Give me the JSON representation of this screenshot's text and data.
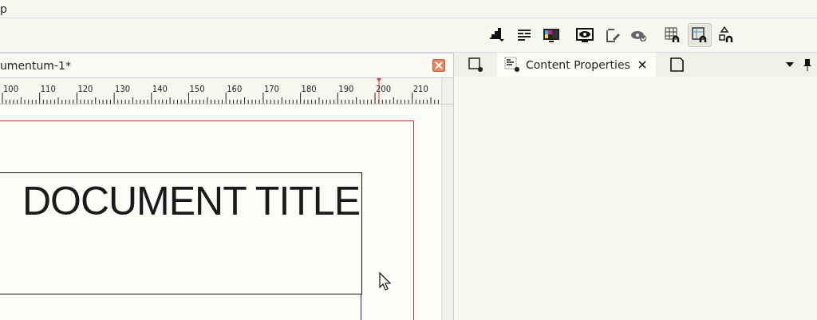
{
  "menu_bar": {
    "items": [
      "p"
    ]
  },
  "toolbar": {
    "tools": [
      {
        "kind": "preview-page",
        "selected": false
      },
      {
        "kind": "text-lines",
        "selected": false
      },
      {
        "kind": "color-monitor",
        "selected": false
      },
      {
        "kind": "eye-monitor",
        "selected": false
      },
      {
        "kind": "page-edit",
        "selected": false
      },
      {
        "kind": "eye-check",
        "selected": false
      },
      {
        "kind": "grid-magnet",
        "selected": false
      },
      {
        "kind": "guide-magnet",
        "selected": true
      },
      {
        "kind": "shape-magnet",
        "selected": false
      }
    ]
  },
  "document_tab": {
    "title": "umentum-1*"
  },
  "ruler": {
    "labels": [
      "100",
      "110",
      "120",
      "130",
      "140",
      "150",
      "160",
      "170",
      "180",
      "190",
      "200",
      "210"
    ]
  },
  "canvas": {
    "title_frame": {
      "text": "DOCUMENT TITLE"
    }
  },
  "side_panel": {
    "tabs": [
      {
        "kind": "icon-frame",
        "selected": false
      },
      {
        "kind": "content",
        "label": "Content Properties",
        "selected": true
      },
      {
        "kind": "icon-page",
        "selected": false
      }
    ]
  }
}
